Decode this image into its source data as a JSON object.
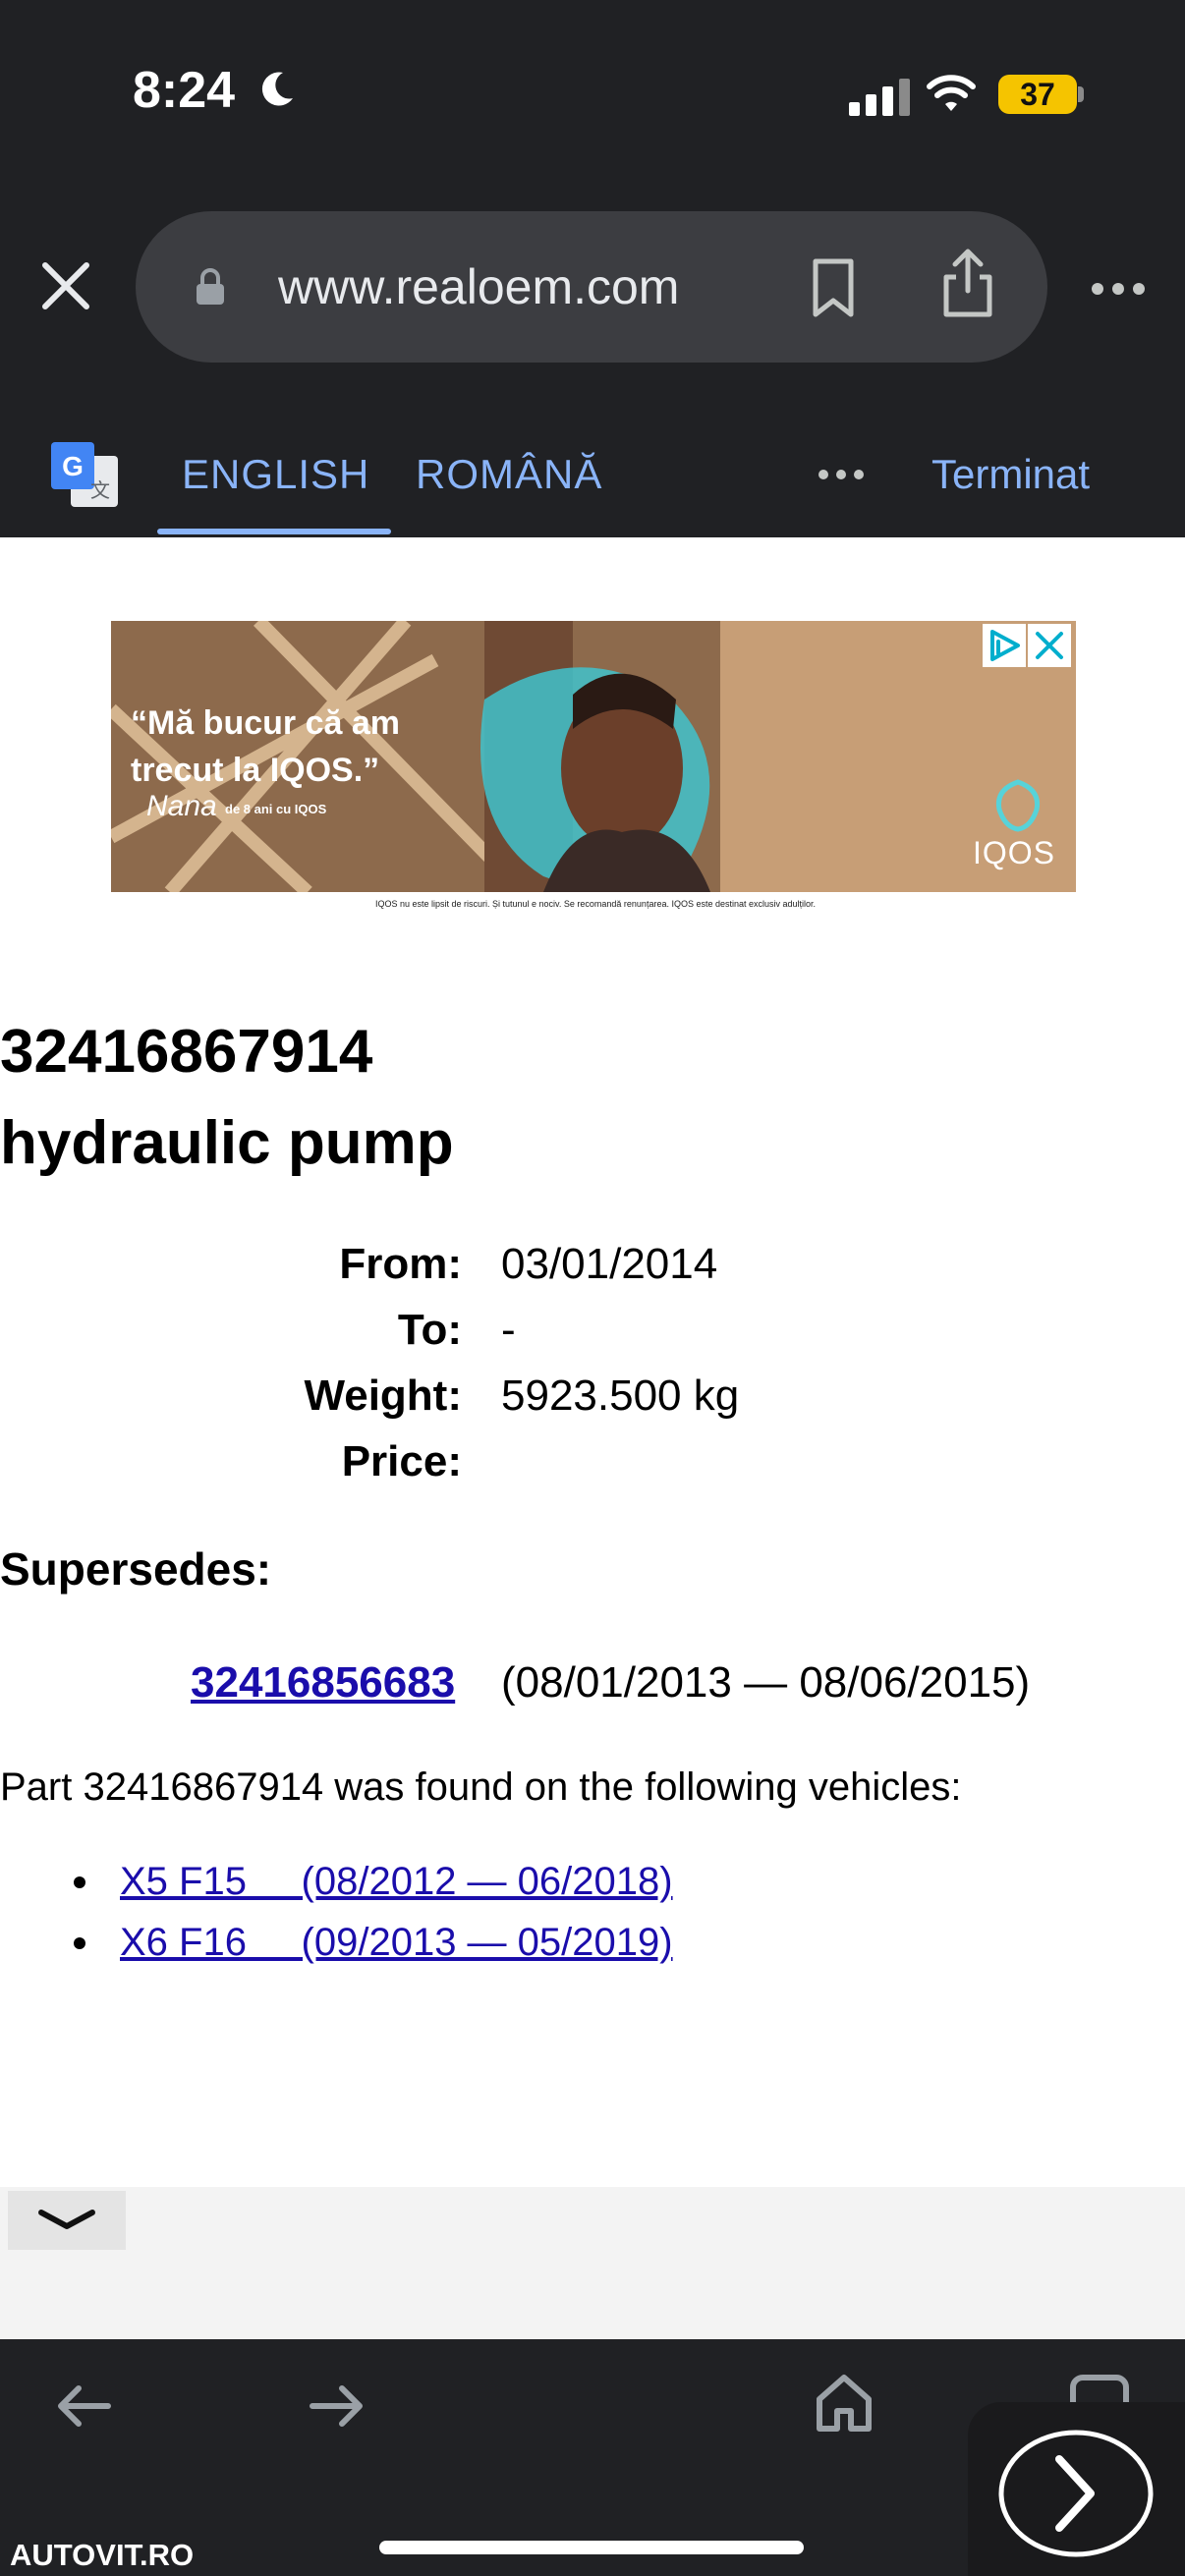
{
  "status_bar": {
    "time": "8:24",
    "battery": "37"
  },
  "browser": {
    "url": "www.realoem.com",
    "translate_bar": {
      "tab_source": "ENGLISH",
      "tab_target": "ROMÂNĂ",
      "done_label": "Terminat"
    }
  },
  "ad": {
    "quote": "“Mă bucur că am\ntrecut la IQOS.”",
    "signature": "Nana",
    "subtitle": "de 8 ani cu IQOS",
    "brand": "IQOS",
    "disclaimer": "IQOS nu este lipsit de riscuri. Și tutunul e nociv. Se recomandă renunțarea. IQOS este destinat exclusiv adulților."
  },
  "part": {
    "number": "32416867914",
    "description": "hydraulic pump",
    "details": [
      {
        "label": "From:",
        "value": "03/01/2014"
      },
      {
        "label": "To:",
        "value": "-"
      },
      {
        "label": "Weight:",
        "value": "5923.500 kg"
      },
      {
        "label": "Price:",
        "value": ""
      }
    ],
    "supersedes_heading": "Supersedes:",
    "supersedes": {
      "part": "32416856683",
      "range": "(08/01/2013 — 08/06/2015)"
    },
    "found_text": "Part 32416867914 was found on the following vehicles:",
    "vehicles": [
      {
        "label": "X5 F15     (08/2012 — 06/2018)"
      },
      {
        "label": "X6 F16     (09/2013 — 05/2019)"
      }
    ]
  },
  "overlay": {
    "watermark": "AUTOVIT.RO"
  },
  "colors": {
    "chrome_bg": "#202124",
    "accent_blue": "#8ab4f8",
    "link": "#1a0dab",
    "battery": "#f5c400"
  }
}
